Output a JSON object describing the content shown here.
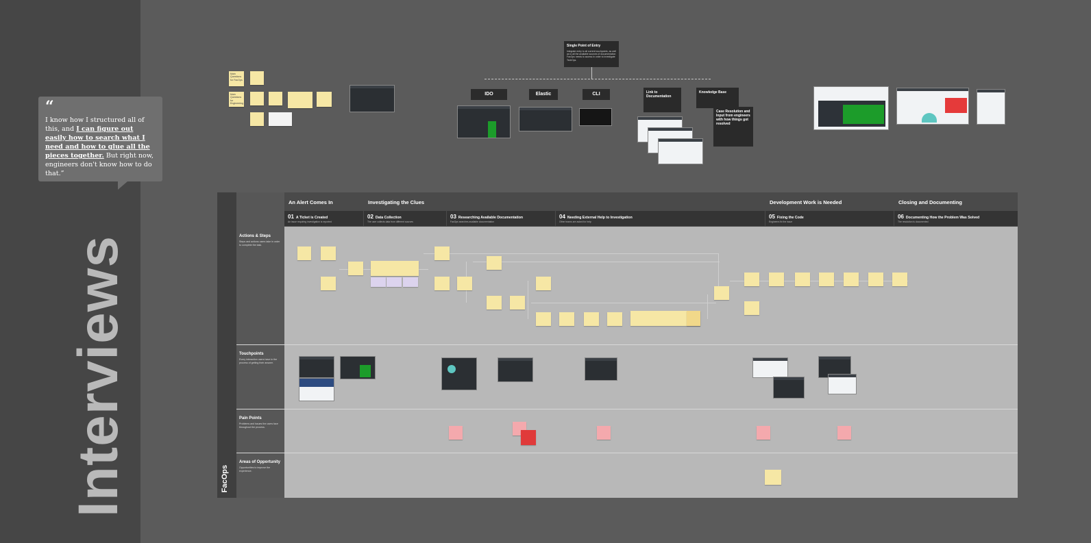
{
  "page": {
    "title": "Interviews",
    "lane": "FacOps"
  },
  "quote": {
    "mark": "“",
    "pre": "I know how I structured all of this, and ",
    "emph": "I can figure out easily how to search what I need and how to glue all the pieces together.",
    "post": " But right now, engineers don't know how to do that.”"
  },
  "board": {
    "entry": {
      "title": "Single Point of Entry",
      "body": "Integrate entry to all current touchpoints, as well as to all the available sources of documentation FacOps needs to access in order to investigate TechOps."
    },
    "tools": [
      "IDO",
      "Elastic",
      "CLI"
    ],
    "docs_link": {
      "title": "Link to Documentation"
    },
    "knowledge": {
      "title": "Knowledge Base"
    },
    "case": {
      "title": "Case Resolution and Input from engineers with how things got resolved"
    },
    "notes_left": [
      "Main Questions for FacOps",
      "Main Questions for Engineering"
    ]
  },
  "phases": [
    {
      "label": "An Alert Comes In"
    },
    {
      "label": "Investigating the Clues"
    },
    {
      "label": "Development Work is Needed"
    },
    {
      "label": "Closing and Documenting"
    }
  ],
  "steps": [
    {
      "num": "01",
      "title": "A Ticket is Created",
      "desc": "An issue requiring investigation is reported"
    },
    {
      "num": "02",
      "title": "Data Collection",
      "desc": "The user collects data from different sources"
    },
    {
      "num": "03",
      "title": "Researching Available Documentation",
      "desc": "FacOps searches available documentation"
    },
    {
      "num": "04",
      "title": "Needing External Help to Investigation",
      "desc": "Other teams are asked for help"
    },
    {
      "num": "05",
      "title": "Fixing the Code",
      "desc": "Engineers fix the issue"
    },
    {
      "num": "06",
      "title": "Documenting How the Problem Was Solved",
      "desc": "The resolution is documented"
    }
  ],
  "rows": [
    {
      "label": "Actions & Steps",
      "desc": "Steps and actions users take in order to complete the task."
    },
    {
      "label": "Touchpoints",
      "desc": "Every interaction users have in the process of getting their answer."
    },
    {
      "label": "Pain Points",
      "desc": "Problems and issues the users face throughout the process."
    },
    {
      "label": "Areas of Opportunity",
      "desc": "Opportunities to improve the experience."
    }
  ],
  "colors": {
    "bg": "#5b5b5b",
    "panel": "#464646",
    "sticky": "#f6e7a5",
    "pink": "#f4a9ad",
    "red": "#e03a3a",
    "row": "#b8b8b8"
  }
}
